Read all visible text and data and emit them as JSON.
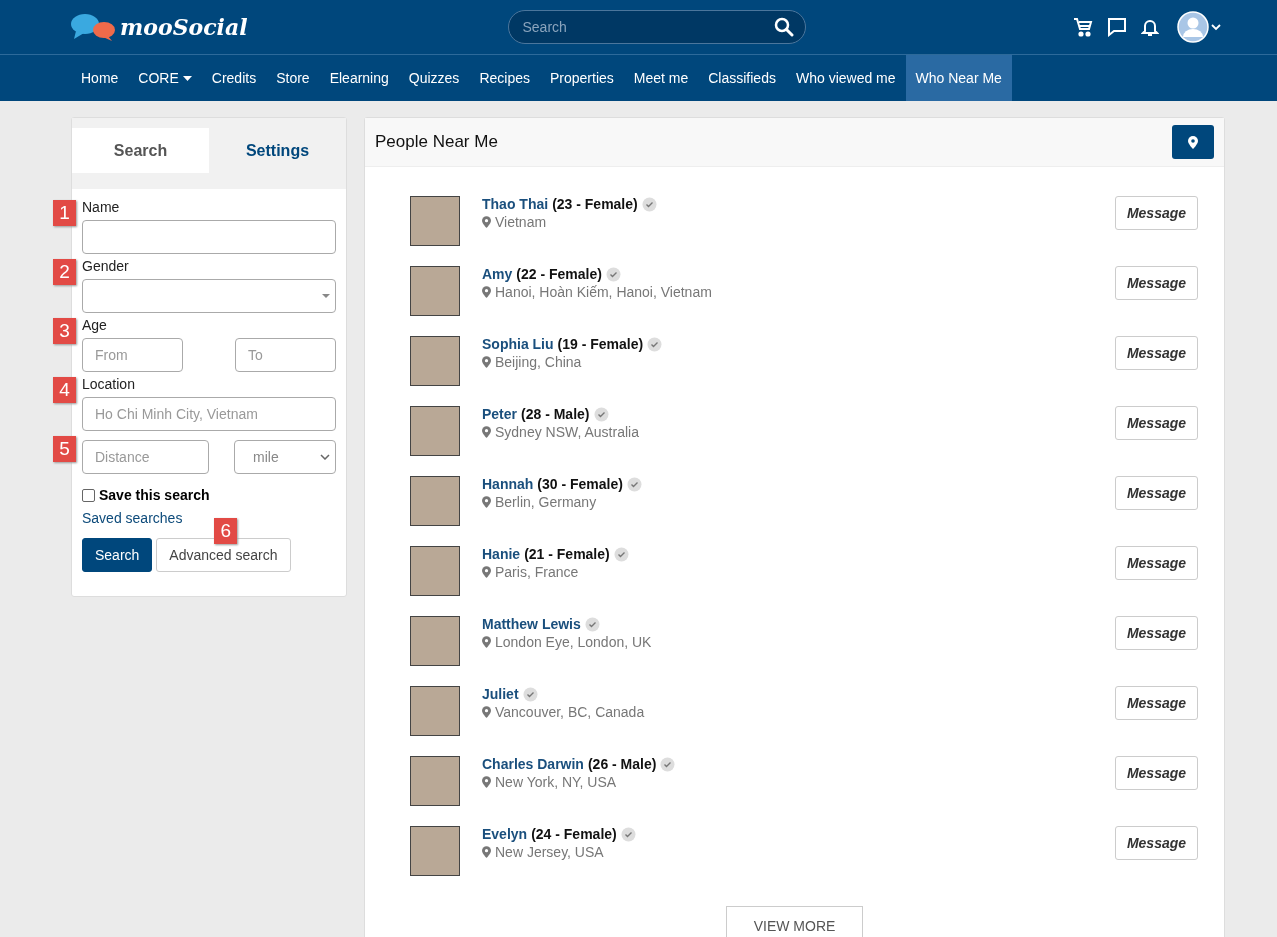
{
  "header": {
    "logo": "mooSocial",
    "search": {
      "placeholder": "Search"
    }
  },
  "nav": [
    {
      "label": "Home",
      "selected": false,
      "dropdown": false
    },
    {
      "label": "CORE",
      "selected": false,
      "dropdown": true
    },
    {
      "label": "Credits",
      "selected": false,
      "dropdown": false
    },
    {
      "label": "Store",
      "selected": false,
      "dropdown": false
    },
    {
      "label": "Elearning",
      "selected": false,
      "dropdown": false
    },
    {
      "label": "Quizzes",
      "selected": false,
      "dropdown": false
    },
    {
      "label": "Recipes",
      "selected": false,
      "dropdown": false
    },
    {
      "label": "Properties",
      "selected": false,
      "dropdown": false
    },
    {
      "label": "Meet me",
      "selected": false,
      "dropdown": false
    },
    {
      "label": "Classifieds",
      "selected": false,
      "dropdown": false
    },
    {
      "label": "Who viewed me",
      "selected": false,
      "dropdown": false
    },
    {
      "label": "Who Near Me",
      "selected": true,
      "dropdown": false
    }
  ],
  "sidebar": {
    "tabs": [
      {
        "label": "Search",
        "selected": true
      },
      {
        "label": "Settings",
        "selected": false
      }
    ],
    "fields": [
      {
        "callout": "1",
        "label": "Name",
        "kind": "text"
      },
      {
        "callout": "2",
        "label": "Gender",
        "kind": "select"
      },
      {
        "callout": "3",
        "label": "Age",
        "kind": "range",
        "from_placeholder": "From",
        "to_placeholder": "To"
      },
      {
        "callout": "4",
        "label": "Location",
        "kind": "location",
        "placeholder": "Ho Chi Minh City, Vietnam"
      },
      {
        "callout": "5",
        "kind": "distance",
        "placeholder": "Distance",
        "unit": "mile"
      }
    ],
    "save_search": {
      "label": "Save this search",
      "checked": false
    },
    "saved_searches_link": "Saved searches",
    "search_button": "Search",
    "advanced_button": {
      "label": "Advanced search",
      "callout": "6"
    }
  },
  "main": {
    "title": "People Near Me",
    "people": [
      {
        "name": "Thao Thai",
        "details": "(23 - Female)",
        "location": "Vietnam",
        "button": "Message"
      },
      {
        "name": "Amy",
        "details": "(22 - Female)",
        "location": "Hanoi, Hoàn Kiếm, Hanoi, Vietnam",
        "button": "Message"
      },
      {
        "name": "Sophia Liu",
        "details": "(19 - Female)",
        "location": "Beijing, China",
        "button": "Message"
      },
      {
        "name": "Peter",
        "details": "(28 - Male)",
        "location": "Sydney NSW, Australia",
        "button": "Message"
      },
      {
        "name": "Hannah",
        "details": "(30 - Female)",
        "location": "Berlin, Germany",
        "button": "Message"
      },
      {
        "name": "Hanie",
        "details": "(21 - Female)",
        "location": "Paris, France",
        "button": "Message"
      },
      {
        "name": "Matthew Lewis",
        "location": "London Eye, London, UK",
        "button": "Message"
      },
      {
        "name": "Juliet",
        "location": "Vancouver, BC, Canada",
        "button": "Message"
      },
      {
        "name": "Charles Darwin",
        "details": "(26 - Male)",
        "location": "New York, NY, USA",
        "button": "Message"
      },
      {
        "name": "Evelyn",
        "details": "(24 - Female)",
        "location": "New Jersey, USA",
        "button": "Message"
      }
    ],
    "view_more": "VIEW MORE"
  }
}
